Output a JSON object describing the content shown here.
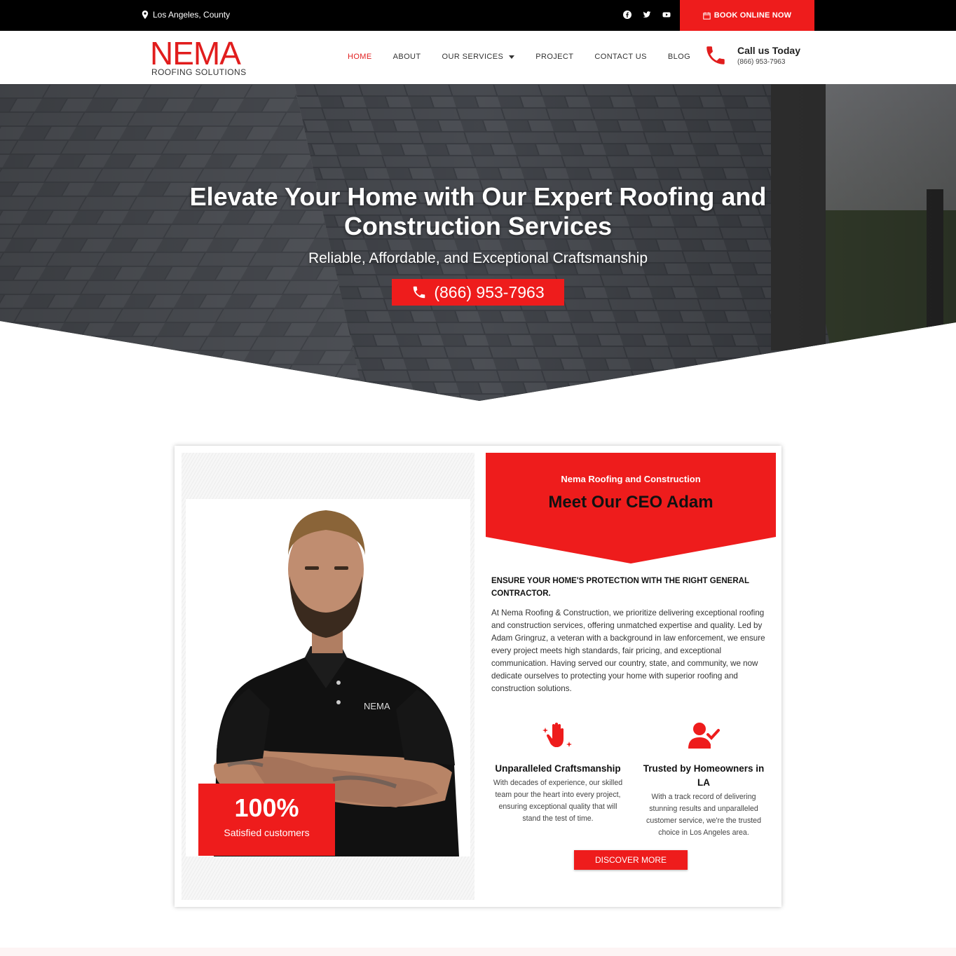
{
  "topbar": {
    "location": "Los Angeles, County",
    "socials": [
      "facebook-icon",
      "twitter-icon",
      "youtube-icon"
    ],
    "book_label": "BOOK ONLINE NOW"
  },
  "header": {
    "logo_brand": "NEMA",
    "logo_sub": "ROOFING SOLUTIONS",
    "nav": [
      {
        "label": "HOME",
        "active": true
      },
      {
        "label": "ABOUT"
      },
      {
        "label": "OUR SERVICES",
        "dropdown": true
      },
      {
        "label": "PROJECT"
      },
      {
        "label": "CONTACT US"
      },
      {
        "label": "BLOG"
      }
    ],
    "call_title": "Call us Today",
    "call_number": "(866) 953-7963"
  },
  "hero": {
    "title": "Elevate Your Home with Our Expert Roofing and Construction Services",
    "subtitle": "Reliable, Affordable, and Exceptional Craftsmanship",
    "phone": "(866) 953-7963"
  },
  "ceo": {
    "stat_value": "100%",
    "stat_label": "Satisfied customers",
    "kicker": "Nema Roofing and Construction",
    "heading": "Meet Our CEO Adam",
    "shirt_logo": "NEMA",
    "intro_heading": "ENSURE YOUR HOME'S PROTECTION WITH THE RIGHT GENERAL CONTRACTOR.",
    "intro_text": "At Nema Roofing & Construction, we prioritize delivering exceptional roofing and construction services, offering unmatched expertise and quality. Led by Adam Gringruz, a veteran with a background in law enforcement, we ensure every project meets high standards, fair pricing, and exceptional communication. Having served our country, state, and community, we now dedicate ourselves to protecting your home with superior roofing and construction solutions.",
    "features": [
      {
        "icon": "hand-sparkle-icon",
        "title": "Unparalleled Craftsmanship",
        "text": "With decades of experience, our skilled team pour the heart into every project, ensuring exceptional quality that will stand the test of time."
      },
      {
        "icon": "user-check-icon",
        "title": "Trusted by Homeowners in LA",
        "text": "With a track record of delivering stunning results and unparalleled customer service, we're the trusted choice in Los Angeles area."
      }
    ],
    "cta_label": "DISCOVER MORE"
  },
  "colors": {
    "accent": "#ee1c1c",
    "topbar": "#000000",
    "text": "#222222"
  }
}
